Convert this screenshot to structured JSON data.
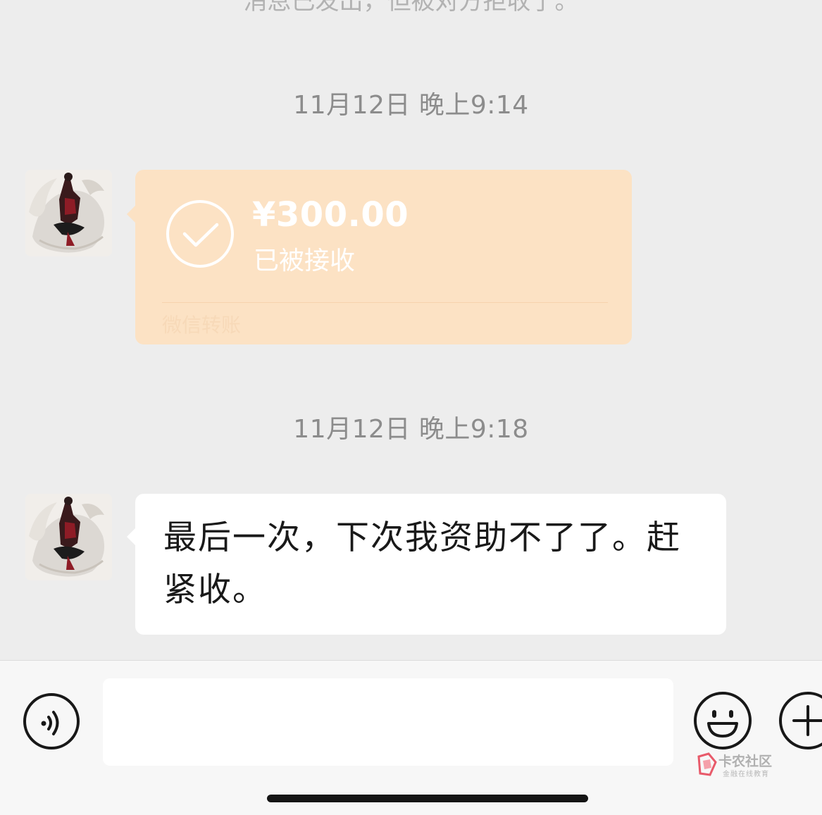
{
  "chat": {
    "top_cutoff_text": "消息已发出，但被对方拒收了。",
    "messages": [
      {
        "timestamp": "11月12日 晚上9:14",
        "type": "transfer",
        "amount": "¥300.00",
        "status": "已被接收",
        "label": "微信转账"
      },
      {
        "timestamp": "11月12日 晚上9:18",
        "type": "text",
        "lines": [
          "最后一次，下次我资助不了了。赶",
          "紧收。"
        ]
      }
    ]
  },
  "input_bar": {
    "text_value": "",
    "icons": [
      "voice-icon",
      "emoji-icon",
      "plus-icon"
    ]
  },
  "watermark": {
    "title": "卡农社区",
    "subtitle": "金融在线教育"
  },
  "colors": {
    "background": "#ededed",
    "transfer_card": "#fce2c4",
    "bubble": "#ffffff",
    "timestamp_text": "#8c8c8c"
  }
}
